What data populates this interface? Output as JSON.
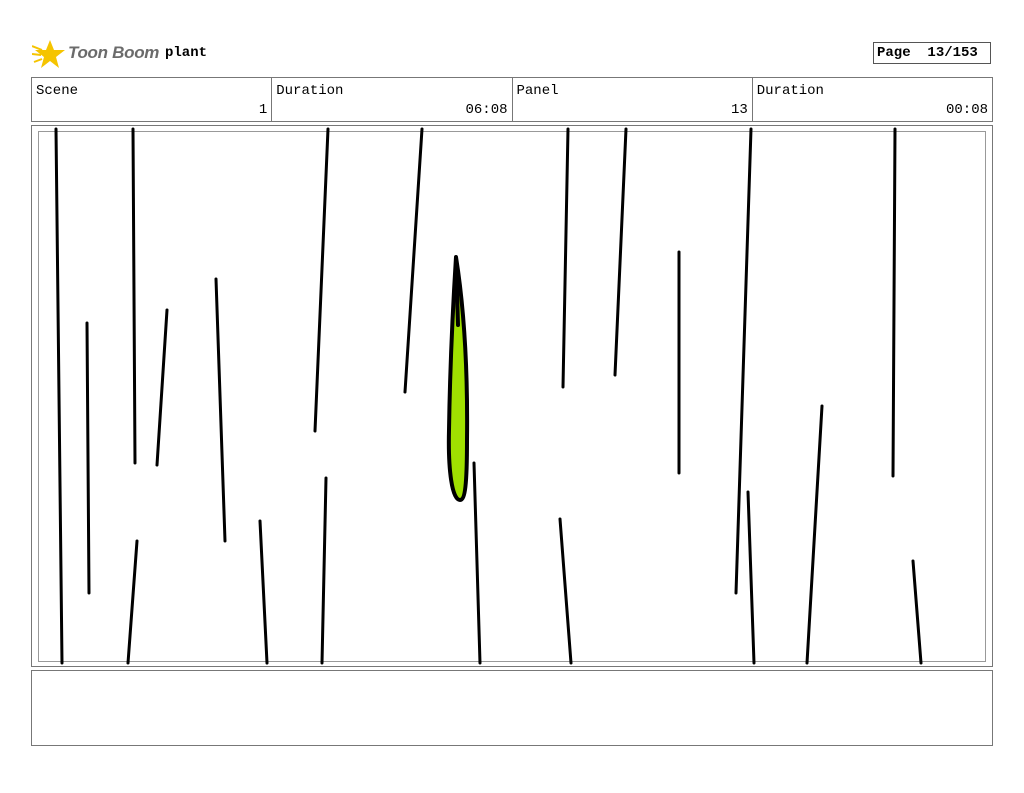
{
  "header": {
    "logo_text": "Toon Boom",
    "project_name": "plant",
    "page_label": "Page",
    "page_value": "13/153"
  },
  "info": {
    "scene_label": "Scene",
    "scene_value": "1",
    "duration_label": "Duration",
    "duration_value": "06:08",
    "panel_label": "Panel",
    "panel_value": "13",
    "panel_duration_label": "Duration",
    "panel_duration_value": "00:08"
  },
  "colors": {
    "logo_accent": "#f5c400",
    "leaf_fill": "#a0e000",
    "stroke": "#000000"
  },
  "notes": {
    "text": ""
  }
}
